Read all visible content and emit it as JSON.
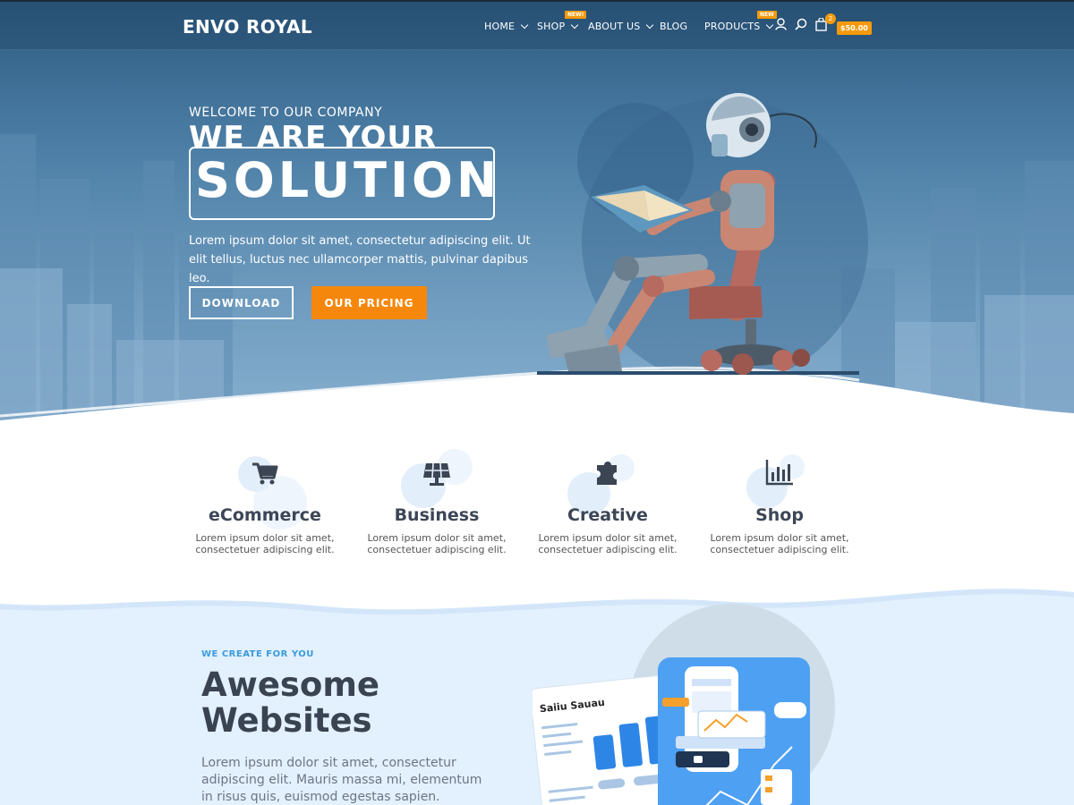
{
  "brand": {
    "name": "ENVO ROYAL"
  },
  "nav": {
    "items": [
      {
        "label": "HOME",
        "dropdown": true
      },
      {
        "label": "SHOP",
        "dropdown": true,
        "badge": "NEW!"
      },
      {
        "label": "ABOUT US",
        "dropdown": true
      },
      {
        "label": "BLOG",
        "dropdown": false
      },
      {
        "label": "PRODUCTS",
        "dropdown": true,
        "badge": "NEW"
      }
    ],
    "icons": [
      "user-icon",
      "search-icon",
      "shopping-bag-icon"
    ],
    "cart": {
      "count": "2",
      "total": "$50.00"
    }
  },
  "hero": {
    "kicker": "WELCOME TO OUR COMPANY",
    "headline_top": "WE ARE YOUR",
    "headline_boxed": "SOLUTION",
    "description": "Lorem ipsum dolor sit amet, consectetur adipiscing elit. Ut elit tellus, luctus nec ullamcorper mattis, pulvinar dapibus leo.",
    "primary_button": "DOWNLOAD",
    "secondary_button": "OUR PRICING"
  },
  "features": [
    {
      "title": "eCommerce",
      "icon": "cart-icon",
      "text": "Lorem ipsum dolor sit amet, consectetuer adipiscing elit."
    },
    {
      "title": "Business",
      "icon": "solar-panel-icon",
      "text": "Lorem ipsum dolor sit amet, consectetuer adipiscing elit."
    },
    {
      "title": "Creative",
      "icon": "puzzle-icon",
      "text": "Lorem ipsum dolor sit amet, consectetuer adipiscing elit."
    },
    {
      "title": "Shop",
      "icon": "bar-chart-icon",
      "text": "Lorem ipsum dolor sit amet, consectetuer adipiscing elit."
    }
  ],
  "websites": {
    "kicker": "WE CREATE FOR YOU",
    "title": "Awesome Websites",
    "description": "Lorem ipsum dolor sit amet, consectetur adipiscing elit. Mauris massa mi, elementum in risus quis, euismod egestas sapien.",
    "illustration_card_title": "Saiiu Sauau"
  },
  "colors": {
    "accent_orange": "#f5880c",
    "badge_orange": "#f59a0c",
    "heading_dark": "#3a4352",
    "kicker_blue": "#3a9bdc",
    "hero_blue": "#4d7fa6"
  }
}
